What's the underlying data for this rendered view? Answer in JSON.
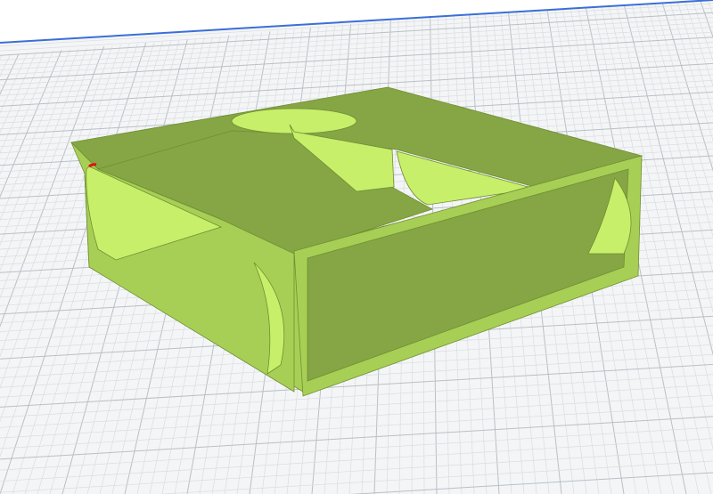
{
  "viewport": {
    "background_color": "#ffffff",
    "horizon_color": "#3a6fd8"
  },
  "build_plate": {
    "grid": true,
    "grid_minor_color": "#d9dde2",
    "grid_major_color": "#b9c0c8",
    "plate_color": "#f4f5f6"
  },
  "model": {
    "color_light": "#c8ef6a",
    "color_mid": "#a7cf55",
    "color_dark": "#86a545",
    "color_shadow": "#6f8f33",
    "edge_highlight_color": "#e01010"
  }
}
